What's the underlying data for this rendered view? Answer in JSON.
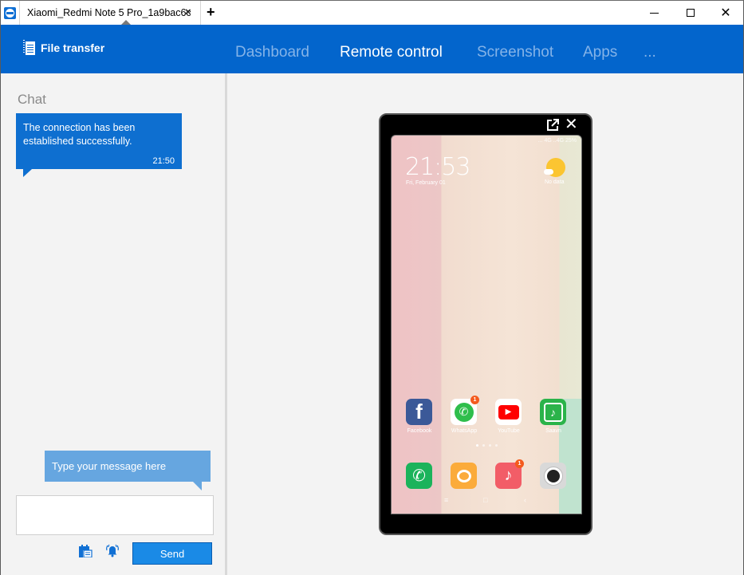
{
  "window": {
    "tab_title": "Xiaomi_Redmi Note 5 Pro_1a9bac6c",
    "tab_close_icon": "×",
    "new_tab_icon": "+",
    "close_icon": "✕"
  },
  "header": {
    "file_transfer_label": "File transfer",
    "nav": [
      {
        "label": "Dashboard",
        "active": false
      },
      {
        "label": "Remote control",
        "active": true
      },
      {
        "label": "Screenshot",
        "active": false
      },
      {
        "label": "Apps",
        "active": false
      },
      {
        "label": "...",
        "active": false
      }
    ],
    "colors": {
      "bar": "#0365cc",
      "inactive": "#84b3e8",
      "active": "#ffffff"
    }
  },
  "chat": {
    "title": "Chat",
    "messages": [
      {
        "text": "The connection has been established successfully.",
        "time": "21:50"
      }
    ],
    "hint": "Type your message here",
    "input_value": "",
    "send_label": "Send"
  },
  "device": {
    "close_icon": "✕",
    "status_bar": "... 4G ..4G 25%",
    "clock": "21:53",
    "date": "Fri, February 01",
    "weather": "No data",
    "apps_row1": [
      {
        "label": "Facebook",
        "glyph": "f",
        "color": "#3b5998",
        "badge": ""
      },
      {
        "label": "WhatsApp",
        "glyph": "✆",
        "color": "#ffffff",
        "badge": "1"
      },
      {
        "label": "YouTube",
        "glyph": "▶",
        "color": "#ffffff",
        "badge": ""
      },
      {
        "label": "Saavn",
        "glyph": "♪",
        "color": "#2bb34a",
        "badge": ""
      }
    ],
    "dock": [
      {
        "label": "Phone",
        "glyph": "✆",
        "color": "#1bb35b",
        "badge": ""
      },
      {
        "label": "Messages",
        "glyph": "💬",
        "color": "#fbab3b",
        "badge": ""
      },
      {
        "label": "Music",
        "glyph": "♪",
        "color": "#f25d67",
        "badge": "1"
      },
      {
        "label": "Camera",
        "glyph": "◉",
        "color": "#d9d9d9",
        "badge": ""
      }
    ],
    "nav_buttons": {
      "menu": "≡",
      "home": "□",
      "back": "‹"
    }
  }
}
